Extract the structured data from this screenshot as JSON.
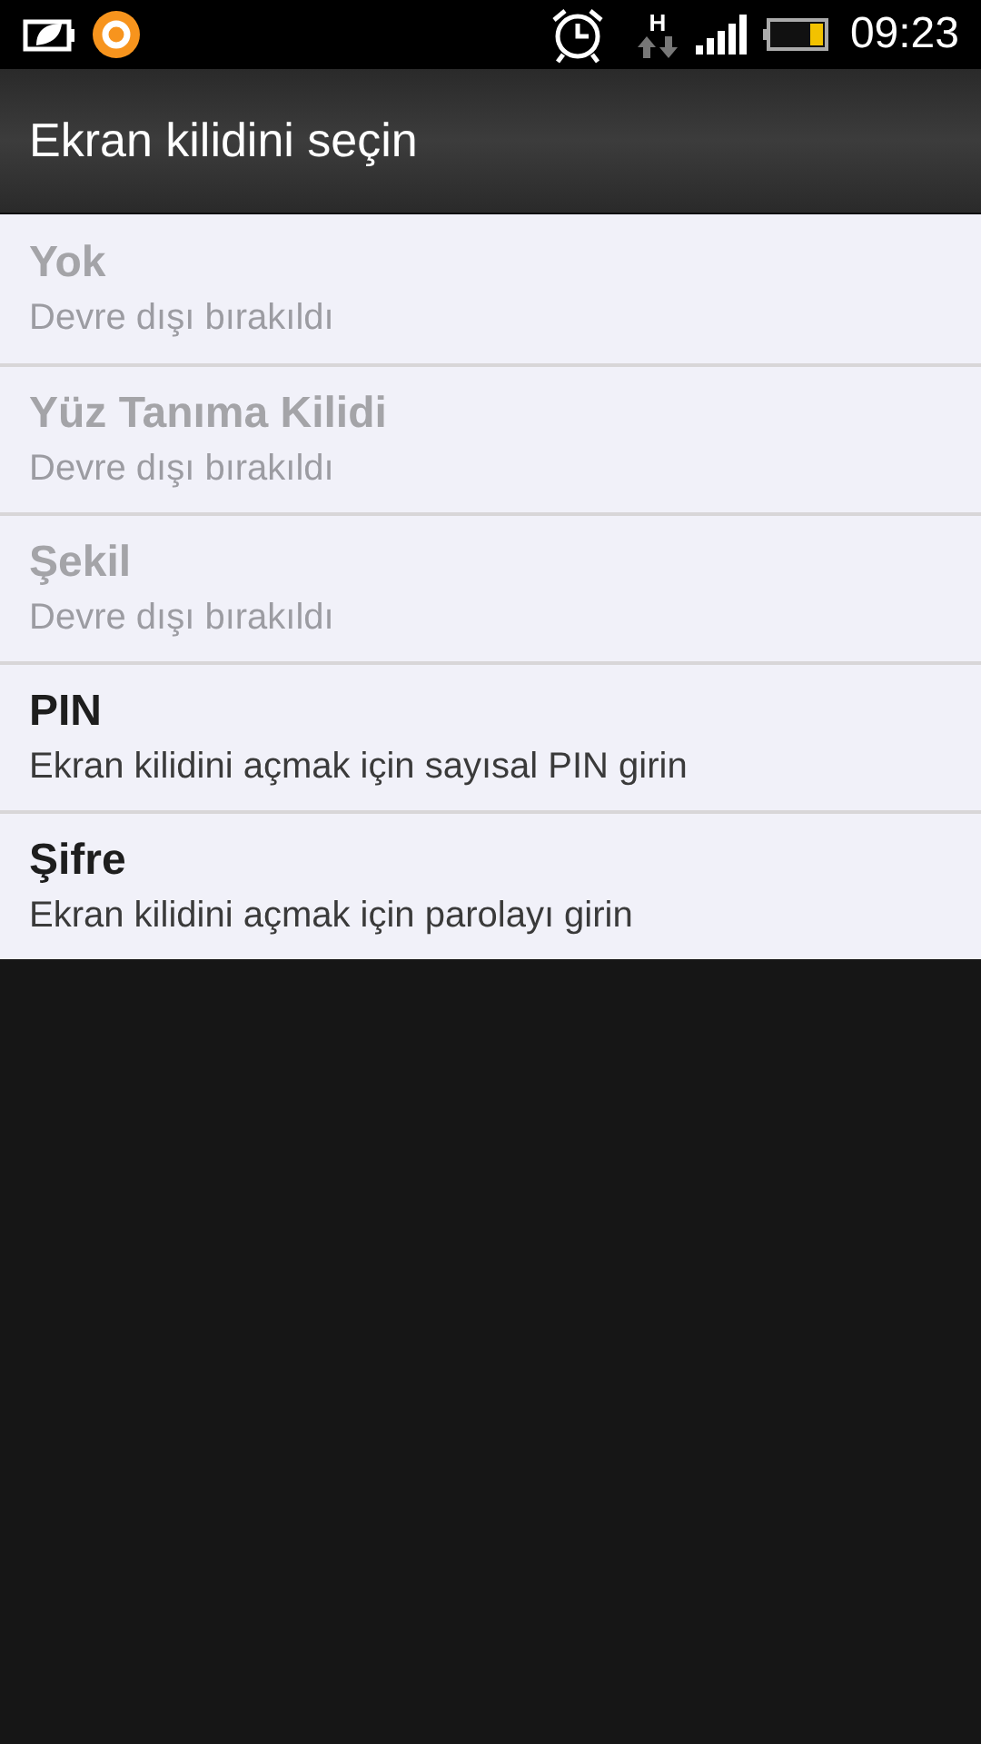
{
  "status_bar": {
    "network": "H",
    "time": "09:23"
  },
  "title": "Ekran kilidini seçin",
  "options": [
    {
      "title": "Yok",
      "summary": "Devre dışı bırakıldı",
      "disabled": true
    },
    {
      "title": "Yüz Tanıma Kilidi",
      "summary": "Devre dışı bırakıldı",
      "disabled": true
    },
    {
      "title": "Şekil",
      "summary": "Devre dışı bırakıldı",
      "disabled": true
    },
    {
      "title": "PIN",
      "summary": "Ekran kilidini açmak için sayısal PIN girin",
      "disabled": false
    },
    {
      "title": "Şifre",
      "summary": "Ekran kilidini açmak için parolayı girin",
      "disabled": false
    }
  ]
}
